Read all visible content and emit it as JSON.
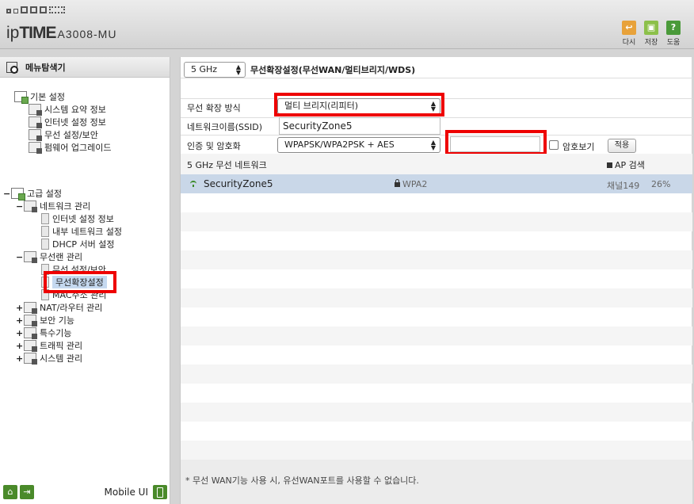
{
  "header": {
    "brand_prefix": "ip",
    "brand_main": "TIME",
    "model": "A3008-MU",
    "actions": [
      {
        "label": "다시",
        "icon": "undo-icon",
        "color": "#e8a23a",
        "glyph": "↩"
      },
      {
        "label": "저장",
        "icon": "save-icon",
        "color": "#8cc04a",
        "glyph": "▣"
      },
      {
        "label": "도움",
        "icon": "help-icon",
        "color": "#4a9a3a",
        "glyph": "?"
      }
    ]
  },
  "sidebar": {
    "title": "메뉴탐색기",
    "basic": {
      "label": "기본 설정",
      "items": [
        "시스템 요약 정보",
        "인터넷 설정 정보",
        "무선 설정/보안",
        "펌웨어 업그레이드"
      ]
    },
    "advanced": {
      "expander": "−",
      "label": "고급 설정",
      "network": {
        "expander": "−",
        "label": "네트워크 관리",
        "items": [
          "인터넷 설정 정보",
          "내부 네트워크 설정",
          "DHCP 서버 설정"
        ]
      },
      "wireless": {
        "expander": "−",
        "label": "무선랜 관리",
        "items": [
          "무선 설정/보안",
          "무선확장설정",
          "MAC주소 관리"
        ]
      },
      "others": [
        {
          "expander": "+",
          "label": "NAT/라우터 관리"
        },
        {
          "expander": "+",
          "label": "보안 기능"
        },
        {
          "expander": "+",
          "label": "특수기능"
        },
        {
          "expander": "+",
          "label": "트래픽 관리"
        },
        {
          "expander": "+",
          "label": "시스템 관리"
        }
      ]
    },
    "footer": {
      "mobile_label": "Mobile UI"
    }
  },
  "main": {
    "band_select": "5 GHz",
    "title": "무선확장설정(무선WAN/멀티브리지/WDS)",
    "mode": {
      "label": "무선 확장 방식",
      "value": "멀티 브리지(리피터)"
    },
    "ssid": {
      "label": "네트워크이름(SSID)",
      "value": "SecurityZone5"
    },
    "auth": {
      "label": "인증 및 암호화",
      "value": "WPAPSK/WPA2PSK + AES",
      "password_value": "",
      "show_password_label": "암호보기",
      "apply_label": "적용"
    },
    "network_list": {
      "title": "5 GHz 무선 네트워크",
      "scan_label": "AP 검색",
      "rows": [
        {
          "ssid": "SecurityZone5",
          "security": "WPA2",
          "channel": "채널149",
          "signal": "26%"
        }
      ]
    },
    "note": "* 무선 WAN기능 사용 시, 유선WAN포트를 사용할 수 없습니다."
  },
  "highlight_color": "#ee0000"
}
